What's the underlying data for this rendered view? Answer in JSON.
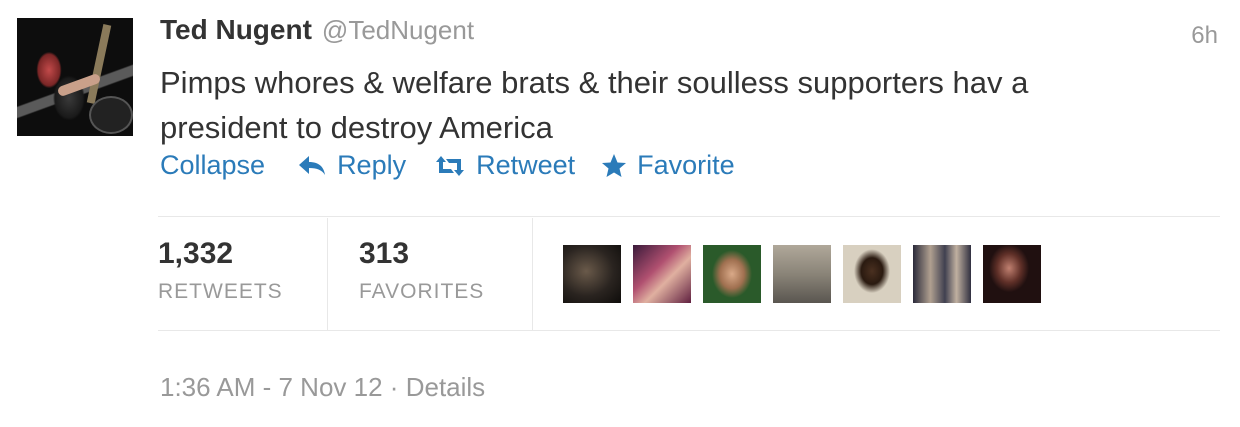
{
  "tweet": {
    "fullname": "Ted Nugent",
    "username": "@TedNugent",
    "time": "6h",
    "text": "Pimps whores & welfare brats & their soulless supporters hav a president to destroy America"
  },
  "actions": {
    "collapse": "Collapse",
    "reply": "Reply",
    "retweet": "Retweet",
    "favorite": "Favorite"
  },
  "stats": {
    "retweets_count": "1,332",
    "retweets_label": "RETWEETS",
    "favorites_count": "313",
    "favorites_label": "FAVORITES"
  },
  "footer": {
    "timestamp": "1:36 AM - 7 Nov 12",
    "separator": "·",
    "details": "Details"
  },
  "colors": {
    "link": "#2b7bb9",
    "text": "#333333",
    "muted": "#999999",
    "divider": "#e8e8e8"
  },
  "icons": {
    "reply": "reply-arrow-icon",
    "retweet": "retweet-icon",
    "favorite": "star-icon"
  }
}
